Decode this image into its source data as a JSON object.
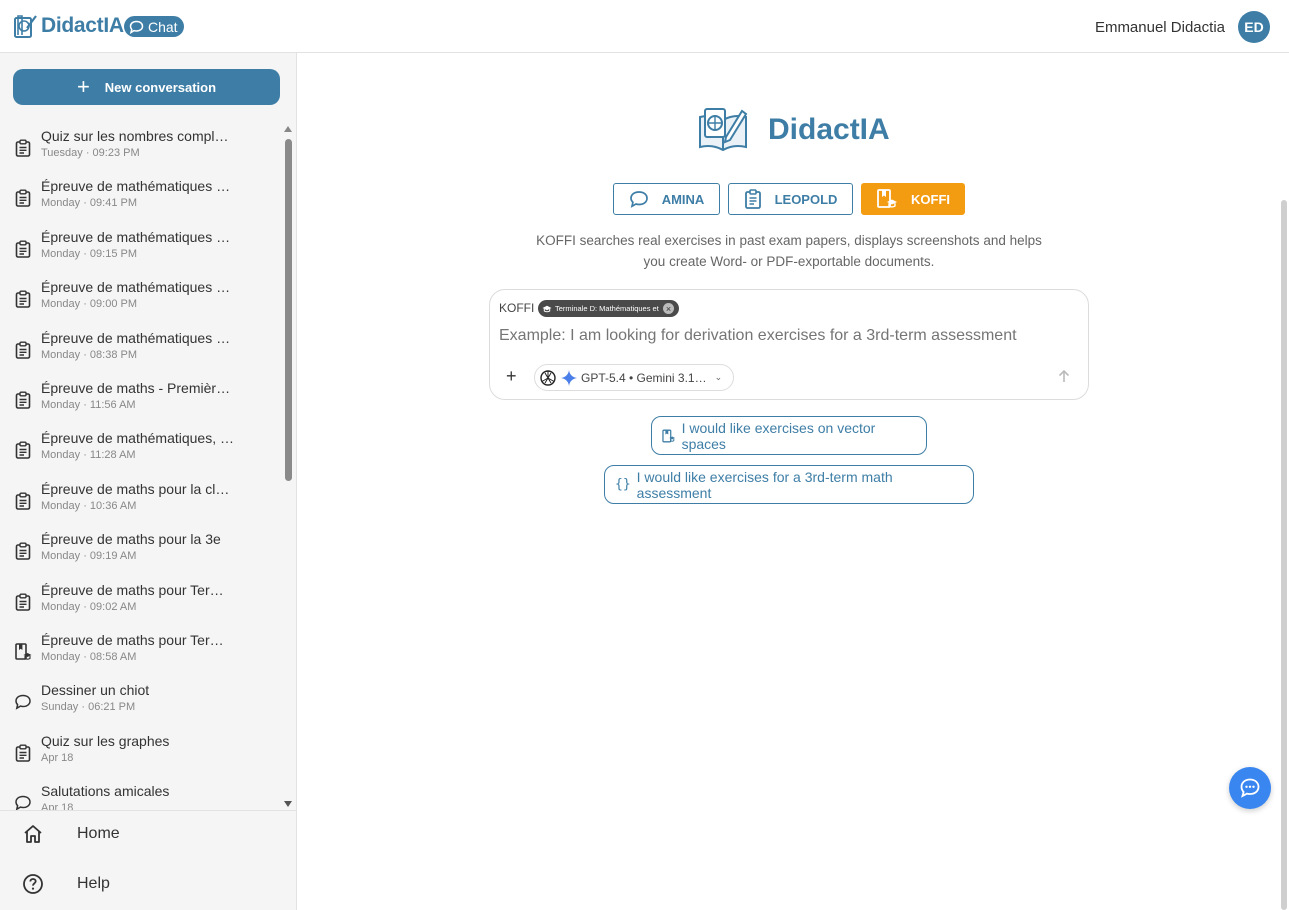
{
  "brand": {
    "name": "DidactIA",
    "chat_label": "Chat"
  },
  "user": {
    "name": "Emmanuel Didactia",
    "initials": "ED"
  },
  "sidebar": {
    "new_conversation_label": "New conversation",
    "conversations": [
      {
        "title": "Quiz sur les nombres compl…",
        "date": "Tuesday · 09:23 PM",
        "icon": "clipboard-icon"
      },
      {
        "title": "Épreuve de mathématiques …",
        "date": "Monday · 09:41 PM",
        "icon": "clipboard-icon"
      },
      {
        "title": "Épreuve de mathématiques …",
        "date": "Monday · 09:15 PM",
        "icon": "clipboard-icon"
      },
      {
        "title": "Épreuve de mathématiques …",
        "date": "Monday · 09:00 PM",
        "icon": "clipboard-icon"
      },
      {
        "title": "Épreuve de mathématiques …",
        "date": "Monday · 08:38 PM",
        "icon": "clipboard-icon"
      },
      {
        "title": "Épreuve de maths - Premièr…",
        "date": "Monday · 11:56 AM",
        "icon": "clipboard-icon"
      },
      {
        "title": "Épreuve de mathématiques, …",
        "date": "Monday · 11:28 AM",
        "icon": "clipboard-icon"
      },
      {
        "title": "Épreuve de maths pour la cl…",
        "date": "Monday · 10:36 AM",
        "icon": "clipboard-icon"
      },
      {
        "title": "Épreuve de maths pour la 3e",
        "date": "Monday · 09:19 AM",
        "icon": "clipboard-icon"
      },
      {
        "title": "Épreuve de maths pour Ter…",
        "date": "Monday · 09:02 AM",
        "icon": "clipboard-icon"
      },
      {
        "title": "Épreuve de maths pour Ter…",
        "date": "Monday · 08:58 AM",
        "icon": "book-cap-icon"
      },
      {
        "title": "Dessiner un chiot",
        "date": "Sunday · 06:21 PM",
        "icon": "chat-bubble-icon"
      },
      {
        "title": "Quiz sur les graphes",
        "date": "Apr 18",
        "icon": "clipboard-icon"
      },
      {
        "title": "Salutations amicales",
        "date": "Apr 18",
        "icon": "chat-bubble-icon"
      }
    ],
    "home_label": "Home",
    "help_label": "Help"
  },
  "main": {
    "logo_name": "DidactIA",
    "agents": [
      {
        "label": "AMINA",
        "icon": "chat-bubble-icon",
        "active": false
      },
      {
        "label": "LEOPOLD",
        "icon": "clipboard-icon",
        "active": false
      },
      {
        "label": "KOFFI",
        "icon": "book-cap-icon",
        "active": true
      }
    ],
    "description_line1": "KOFFI searches real exercises in past exam papers, displays screenshots and helps",
    "description_line2": "you create Word- or PDF-exportable documents.",
    "composer": {
      "agent_label": "KOFFI",
      "chip_text": "Terminale D: Mathématiques et",
      "placeholder": "Example: I am looking for derivation exercises for a 3rd-term assessment",
      "add_label": "+",
      "model_label": "GPT-5.4 • Gemini 3.1…"
    },
    "suggestions": [
      {
        "text": "I would like exercises on vector spaces",
        "icon": "book-cap-icon"
      },
      {
        "text": "I would like exercises for a 3rd-term math assessment",
        "icon": "braces-icon"
      }
    ]
  },
  "colors": {
    "accent": "#3e7ea6",
    "active_agent": "#f39c12",
    "fab": "#3a86f0"
  }
}
